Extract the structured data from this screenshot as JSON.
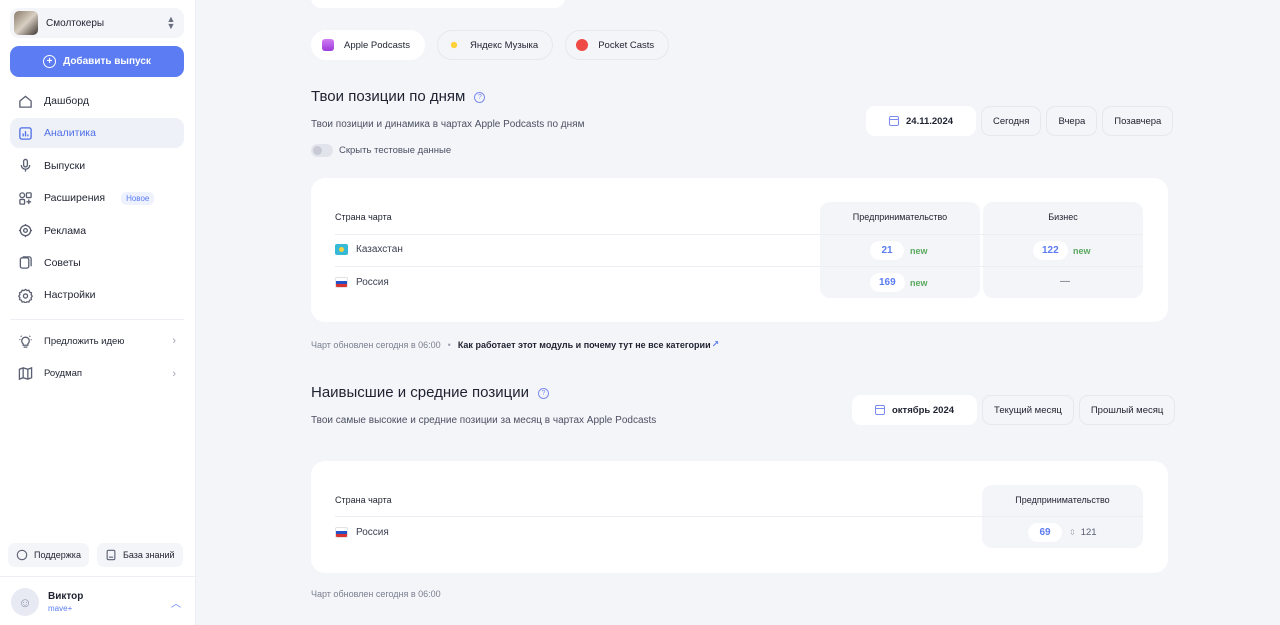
{
  "sidebar": {
    "podcast_name": "Смолтокеры",
    "add_button": "Добавить выпуск",
    "items": [
      {
        "label": "Дашборд",
        "icon": "home-icon"
      },
      {
        "label": "Аналитика",
        "icon": "chart-icon",
        "active": true
      },
      {
        "label": "Выпуски",
        "icon": "microphone-icon"
      },
      {
        "label": "Расширения",
        "icon": "extensions-icon",
        "badge": "Новое"
      },
      {
        "label": "Реклама",
        "icon": "target-icon"
      },
      {
        "label": "Советы",
        "icon": "tips-icon"
      },
      {
        "label": "Настройки",
        "icon": "gear-icon"
      }
    ],
    "secondary": [
      {
        "label": "Предложить идею",
        "icon": "lightbulb-icon"
      },
      {
        "label": "Роудмап",
        "icon": "map-icon"
      }
    ],
    "support": "Поддержка",
    "knowledge": "База знаний",
    "user": {
      "name": "Виктор",
      "org": "mave+"
    }
  },
  "platforms": [
    "Apple Podcasts",
    "Яндекс Музыка",
    "Pocket Casts"
  ],
  "daily": {
    "title": "Твои позиции по дням",
    "subtitle": "Твои позиции и динамика в чартах Apple Podcasts по дням",
    "date": "24.11.2024",
    "buttons": [
      "Сегодня",
      "Вчера",
      "Позавчера"
    ],
    "toggle_label": "Скрыть тестовые данные",
    "table": {
      "country_header": "Страна чарта",
      "columns": [
        "Предпринимательство",
        "Бизнес"
      ],
      "rows": [
        {
          "country": "Казахстан",
          "c1": "21",
          "c1_tag": "new",
          "c2": "122",
          "c2_tag": "new"
        },
        {
          "country": "Россия",
          "c1": "169",
          "c1_tag": "new",
          "c2": "—"
        }
      ]
    },
    "updated": "Чарт обновлен сегодня в 06:00",
    "sep": "•",
    "link": "Как работает этот модуль и почему тут не все категории",
    "link_arrow": "↗"
  },
  "monthly": {
    "title": "Наивысшие и средние позиции",
    "subtitle": "Твои самые высокие и средние позиции за месяц в чартах Apple Podcasts",
    "month": "октябрь 2024",
    "buttons": [
      "Текущий месяц",
      "Прошлый месяц"
    ],
    "table": {
      "country_header": "Страна чарта",
      "column": "Предпринимательство",
      "rows": [
        {
          "country": "Россия",
          "best": "69",
          "avg": "121"
        }
      ]
    },
    "updated": "Чарт обновлен сегодня в 06:00"
  },
  "colors": {
    "accent": "#5b7cf2",
    "new_tag": "#5aa85f",
    "background": "#f4f5f9"
  }
}
